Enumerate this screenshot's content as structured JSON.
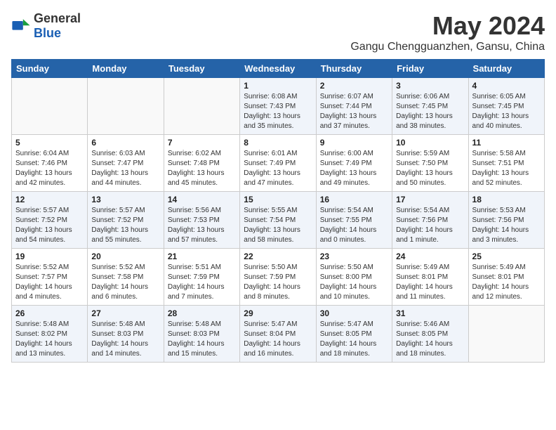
{
  "header": {
    "logo_general": "General",
    "logo_blue": "Blue",
    "title": "May 2024",
    "subtitle": "Gangu Chengguanzhen, Gansu, China"
  },
  "days_of_week": [
    "Sunday",
    "Monday",
    "Tuesday",
    "Wednesday",
    "Thursday",
    "Friday",
    "Saturday"
  ],
  "weeks": [
    [
      {
        "day": "",
        "sunrise": "",
        "sunset": "",
        "daylight": ""
      },
      {
        "day": "",
        "sunrise": "",
        "sunset": "",
        "daylight": ""
      },
      {
        "day": "",
        "sunrise": "",
        "sunset": "",
        "daylight": ""
      },
      {
        "day": "1",
        "sunrise": "Sunrise: 6:08 AM",
        "sunset": "Sunset: 7:43 PM",
        "daylight": "Daylight: 13 hours and 35 minutes."
      },
      {
        "day": "2",
        "sunrise": "Sunrise: 6:07 AM",
        "sunset": "Sunset: 7:44 PM",
        "daylight": "Daylight: 13 hours and 37 minutes."
      },
      {
        "day": "3",
        "sunrise": "Sunrise: 6:06 AM",
        "sunset": "Sunset: 7:45 PM",
        "daylight": "Daylight: 13 hours and 38 minutes."
      },
      {
        "day": "4",
        "sunrise": "Sunrise: 6:05 AM",
        "sunset": "Sunset: 7:45 PM",
        "daylight": "Daylight: 13 hours and 40 minutes."
      }
    ],
    [
      {
        "day": "5",
        "sunrise": "Sunrise: 6:04 AM",
        "sunset": "Sunset: 7:46 PM",
        "daylight": "Daylight: 13 hours and 42 minutes."
      },
      {
        "day": "6",
        "sunrise": "Sunrise: 6:03 AM",
        "sunset": "Sunset: 7:47 PM",
        "daylight": "Daylight: 13 hours and 44 minutes."
      },
      {
        "day": "7",
        "sunrise": "Sunrise: 6:02 AM",
        "sunset": "Sunset: 7:48 PM",
        "daylight": "Daylight: 13 hours and 45 minutes."
      },
      {
        "day": "8",
        "sunrise": "Sunrise: 6:01 AM",
        "sunset": "Sunset: 7:49 PM",
        "daylight": "Daylight: 13 hours and 47 minutes."
      },
      {
        "day": "9",
        "sunrise": "Sunrise: 6:00 AM",
        "sunset": "Sunset: 7:49 PM",
        "daylight": "Daylight: 13 hours and 49 minutes."
      },
      {
        "day": "10",
        "sunrise": "Sunrise: 5:59 AM",
        "sunset": "Sunset: 7:50 PM",
        "daylight": "Daylight: 13 hours and 50 minutes."
      },
      {
        "day": "11",
        "sunrise": "Sunrise: 5:58 AM",
        "sunset": "Sunset: 7:51 PM",
        "daylight": "Daylight: 13 hours and 52 minutes."
      }
    ],
    [
      {
        "day": "12",
        "sunrise": "Sunrise: 5:57 AM",
        "sunset": "Sunset: 7:52 PM",
        "daylight": "Daylight: 13 hours and 54 minutes."
      },
      {
        "day": "13",
        "sunrise": "Sunrise: 5:57 AM",
        "sunset": "Sunset: 7:52 PM",
        "daylight": "Daylight: 13 hours and 55 minutes."
      },
      {
        "day": "14",
        "sunrise": "Sunrise: 5:56 AM",
        "sunset": "Sunset: 7:53 PM",
        "daylight": "Daylight: 13 hours and 57 minutes."
      },
      {
        "day": "15",
        "sunrise": "Sunrise: 5:55 AM",
        "sunset": "Sunset: 7:54 PM",
        "daylight": "Daylight: 13 hours and 58 minutes."
      },
      {
        "day": "16",
        "sunrise": "Sunrise: 5:54 AM",
        "sunset": "Sunset: 7:55 PM",
        "daylight": "Daylight: 14 hours and 0 minutes."
      },
      {
        "day": "17",
        "sunrise": "Sunrise: 5:54 AM",
        "sunset": "Sunset: 7:56 PM",
        "daylight": "Daylight: 14 hours and 1 minute."
      },
      {
        "day": "18",
        "sunrise": "Sunrise: 5:53 AM",
        "sunset": "Sunset: 7:56 PM",
        "daylight": "Daylight: 14 hours and 3 minutes."
      }
    ],
    [
      {
        "day": "19",
        "sunrise": "Sunrise: 5:52 AM",
        "sunset": "Sunset: 7:57 PM",
        "daylight": "Daylight: 14 hours and 4 minutes."
      },
      {
        "day": "20",
        "sunrise": "Sunrise: 5:52 AM",
        "sunset": "Sunset: 7:58 PM",
        "daylight": "Daylight: 14 hours and 6 minutes."
      },
      {
        "day": "21",
        "sunrise": "Sunrise: 5:51 AM",
        "sunset": "Sunset: 7:59 PM",
        "daylight": "Daylight: 14 hours and 7 minutes."
      },
      {
        "day": "22",
        "sunrise": "Sunrise: 5:50 AM",
        "sunset": "Sunset: 7:59 PM",
        "daylight": "Daylight: 14 hours and 8 minutes."
      },
      {
        "day": "23",
        "sunrise": "Sunrise: 5:50 AM",
        "sunset": "Sunset: 8:00 PM",
        "daylight": "Daylight: 14 hours and 10 minutes."
      },
      {
        "day": "24",
        "sunrise": "Sunrise: 5:49 AM",
        "sunset": "Sunset: 8:01 PM",
        "daylight": "Daylight: 14 hours and 11 minutes."
      },
      {
        "day": "25",
        "sunrise": "Sunrise: 5:49 AM",
        "sunset": "Sunset: 8:01 PM",
        "daylight": "Daylight: 14 hours and 12 minutes."
      }
    ],
    [
      {
        "day": "26",
        "sunrise": "Sunrise: 5:48 AM",
        "sunset": "Sunset: 8:02 PM",
        "daylight": "Daylight: 14 hours and 13 minutes."
      },
      {
        "day": "27",
        "sunrise": "Sunrise: 5:48 AM",
        "sunset": "Sunset: 8:03 PM",
        "daylight": "Daylight: 14 hours and 14 minutes."
      },
      {
        "day": "28",
        "sunrise": "Sunrise: 5:48 AM",
        "sunset": "Sunset: 8:03 PM",
        "daylight": "Daylight: 14 hours and 15 minutes."
      },
      {
        "day": "29",
        "sunrise": "Sunrise: 5:47 AM",
        "sunset": "Sunset: 8:04 PM",
        "daylight": "Daylight: 14 hours and 16 minutes."
      },
      {
        "day": "30",
        "sunrise": "Sunrise: 5:47 AM",
        "sunset": "Sunset: 8:05 PM",
        "daylight": "Daylight: 14 hours and 18 minutes."
      },
      {
        "day": "31",
        "sunrise": "Sunrise: 5:46 AM",
        "sunset": "Sunset: 8:05 PM",
        "daylight": "Daylight: 14 hours and 18 minutes."
      },
      {
        "day": "",
        "sunrise": "",
        "sunset": "",
        "daylight": ""
      }
    ]
  ]
}
